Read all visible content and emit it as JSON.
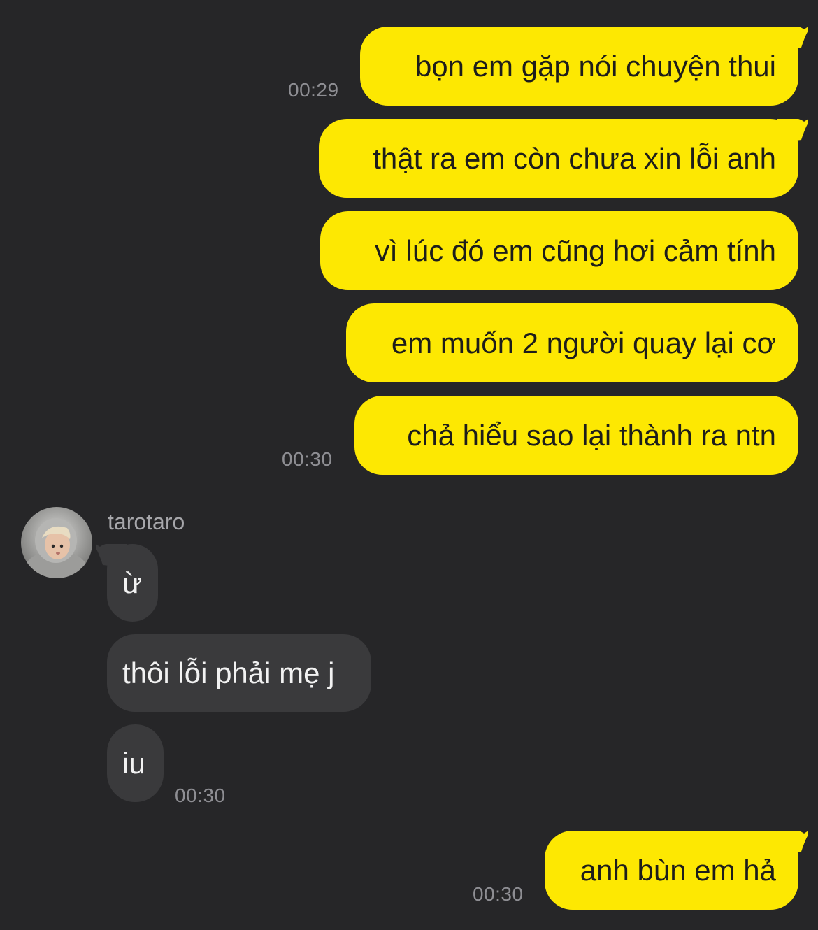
{
  "conversation": {
    "contact_name": "tarotaro",
    "colors": {
      "background": "#262628",
      "outgoing_bubble": "#fde802",
      "incoming_bubble": "#3a3a3c",
      "timestamp": "#8e8e93"
    },
    "messages": [
      {
        "direction": "outgoing",
        "text": "bọn em gặp nói chuyện thui",
        "time": "00:29"
      },
      {
        "direction": "outgoing",
        "text": "thật ra em còn chưa xin lỗi anh",
        "time": ""
      },
      {
        "direction": "outgoing",
        "text": "vì lúc đó em cũng hơi cảm tính",
        "time": ""
      },
      {
        "direction": "outgoing",
        "text": "em muốn 2 người quay lại cơ",
        "time": ""
      },
      {
        "direction": "outgoing",
        "text": "chả hiểu sao lại thành ra ntn",
        "time": "00:30"
      },
      {
        "direction": "incoming",
        "text": "ừ",
        "time": ""
      },
      {
        "direction": "incoming",
        "text": "thôi lỗi phải mẹ j",
        "time": ""
      },
      {
        "direction": "incoming",
        "text": "iu",
        "time": "00:30"
      },
      {
        "direction": "outgoing",
        "text": "anh bùn em hả",
        "time": "00:30"
      }
    ],
    "avatar_icon": "user-photo-avatar"
  }
}
